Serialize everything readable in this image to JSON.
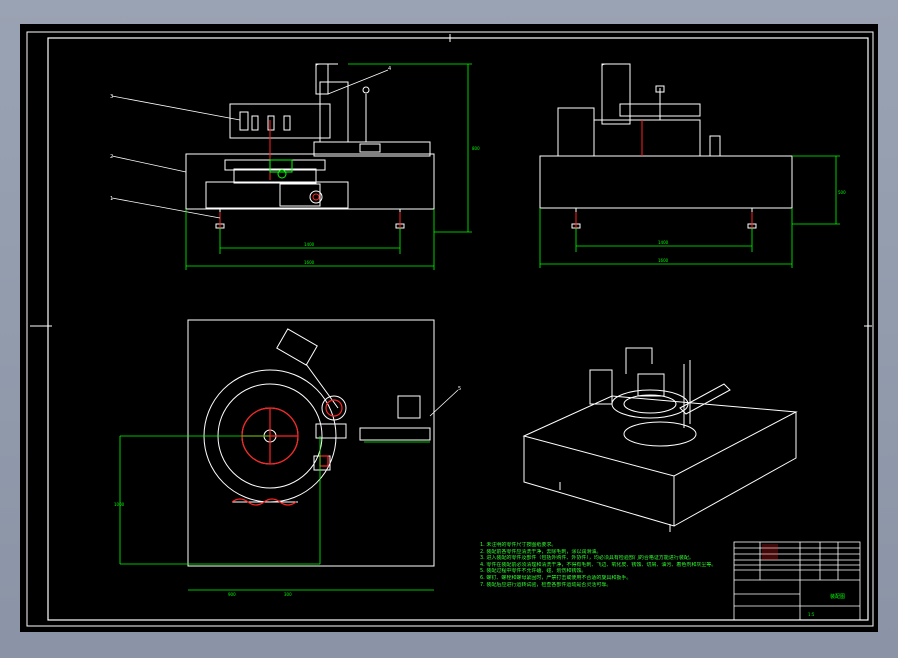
{
  "drawing": {
    "colors": {
      "outline": "#ffffff",
      "dimension": "#00ff00",
      "highlight": "#ff2020",
      "background": "#000000",
      "frame": "#8a94a6"
    },
    "tech_notes": [
      "1. 未注明的零件尺寸按图纸要求。",
      "2. 装配前各零件应清洗干净，去除毛刺，涂以润滑油。",
      "3. 进入装配的零件及部件（包括外购件、外协件），均必须具有检验部门的合格证方能进行装配。",
      "4. 零件在装配前必须清理和清洗干净，不得有毛刺、飞边、氧化皮、锈蚀、切屑、油污、着色剂和灰尘等。",
      "5. 装配过程中零件不允许磕、碰、划伤和锈蚀。",
      "6. 螺钉、螺栓和螺母紧固时，严禁打击或使用不合适的旋具和扳手。",
      "7. 装配后应进行运转试验，检查各部件运动是否灵活可靠。"
    ],
    "callouts": [
      "1",
      "2",
      "3",
      "4",
      "5"
    ],
    "dimensions": {
      "top_left_height": "800",
      "top_left_span_inner": "1400",
      "top_left_span_outer": "1600",
      "top_right_height": "500",
      "top_right_span_inner": "1400",
      "top_right_span_outer": "1600",
      "plan_width": "900",
      "plan_height": "1000",
      "plan_offset": "300"
    },
    "title_block": {
      "drawing_name": "装配图",
      "scale": "1:5"
    }
  }
}
